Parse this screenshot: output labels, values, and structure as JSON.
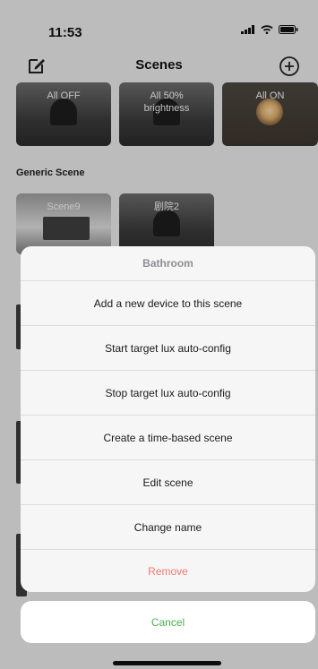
{
  "status": {
    "time": "11:53"
  },
  "nav": {
    "title": "Scenes"
  },
  "scenes_top": [
    {
      "label": "All OFF",
      "style": "dark"
    },
    {
      "label": "All 50%\nbrightness",
      "style": "dark"
    },
    {
      "label": "All ON",
      "style": "on"
    }
  ],
  "section": {
    "title": "Generic Scene"
  },
  "generic_scenes": [
    {
      "label": "Scene9",
      "style": "laptop"
    },
    {
      "label": "剧院2",
      "style": "dark"
    }
  ],
  "sheet": {
    "title": "Bathroom",
    "items": [
      {
        "label": "Add a new device to this scene"
      },
      {
        "label": "Start target lux auto-config"
      },
      {
        "label": "Stop target lux auto-config"
      },
      {
        "label": "Create a time-based scene"
      },
      {
        "label": "Edit scene"
      },
      {
        "label": "Change name"
      },
      {
        "label": "Remove",
        "danger": true
      }
    ],
    "cancel_label": "Cancel"
  },
  "colors": {
    "danger": "#f47a72",
    "cancel": "#4caf50",
    "sheet_title": "#8e8e93"
  }
}
